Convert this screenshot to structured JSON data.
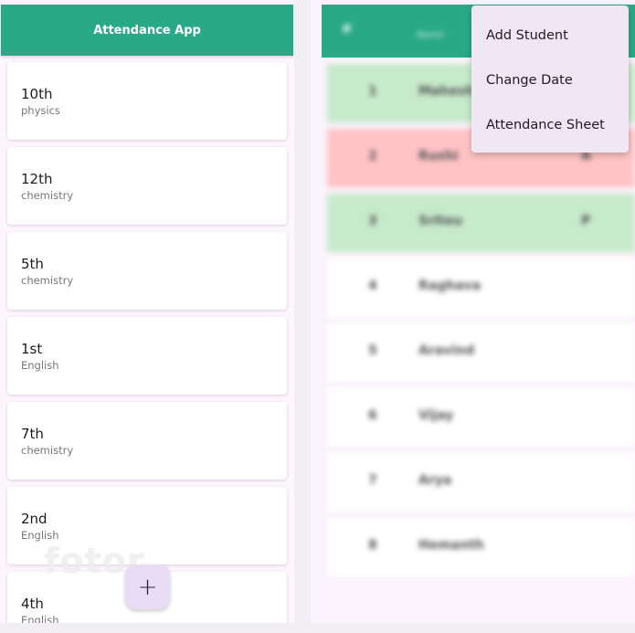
{
  "app": {
    "title": "Attendance App"
  },
  "classes": [
    {
      "name": "10th",
      "subject": "physics"
    },
    {
      "name": "12th",
      "subject": "chemistry"
    },
    {
      "name": "5th",
      "subject": "chemistry"
    },
    {
      "name": "1st",
      "subject": "English"
    },
    {
      "name": "7th",
      "subject": "chemistry"
    },
    {
      "name": "2nd",
      "subject": "English"
    },
    {
      "name": "4th",
      "subject": "English"
    }
  ],
  "fab": {
    "label": "+"
  },
  "watermark": "fotor",
  "sheet": {
    "header": {
      "number_col": "#",
      "name_col": "Name"
    },
    "students": [
      {
        "number": "1",
        "name": "Mahesh",
        "mark": "",
        "status": "present"
      },
      {
        "number": "2",
        "name": "Rushi",
        "mark": "A",
        "status": "absent"
      },
      {
        "number": "3",
        "name": "Sriteu",
        "mark": "P",
        "status": "present"
      },
      {
        "number": "4",
        "name": "Raghava",
        "mark": "",
        "status": "none"
      },
      {
        "number": "5",
        "name": "Aravind",
        "mark": "",
        "status": "none"
      },
      {
        "number": "6",
        "name": "Vijay",
        "mark": "",
        "status": "none"
      },
      {
        "number": "7",
        "name": "Arya",
        "mark": "",
        "status": "none"
      },
      {
        "number": "8",
        "name": "Hemanth",
        "mark": "",
        "status": "none"
      }
    ],
    "status_colors": {
      "present": "#c7eacb",
      "absent": "#ffc3c6",
      "none": "#ffffff"
    }
  },
  "menu": {
    "items": [
      {
        "label": "Add Student"
      },
      {
        "label": "Change Date"
      },
      {
        "label": "Attendance Sheet"
      }
    ]
  },
  "colors": {
    "accent": "#2aa987",
    "fab_bg": "#e9dcf5"
  }
}
